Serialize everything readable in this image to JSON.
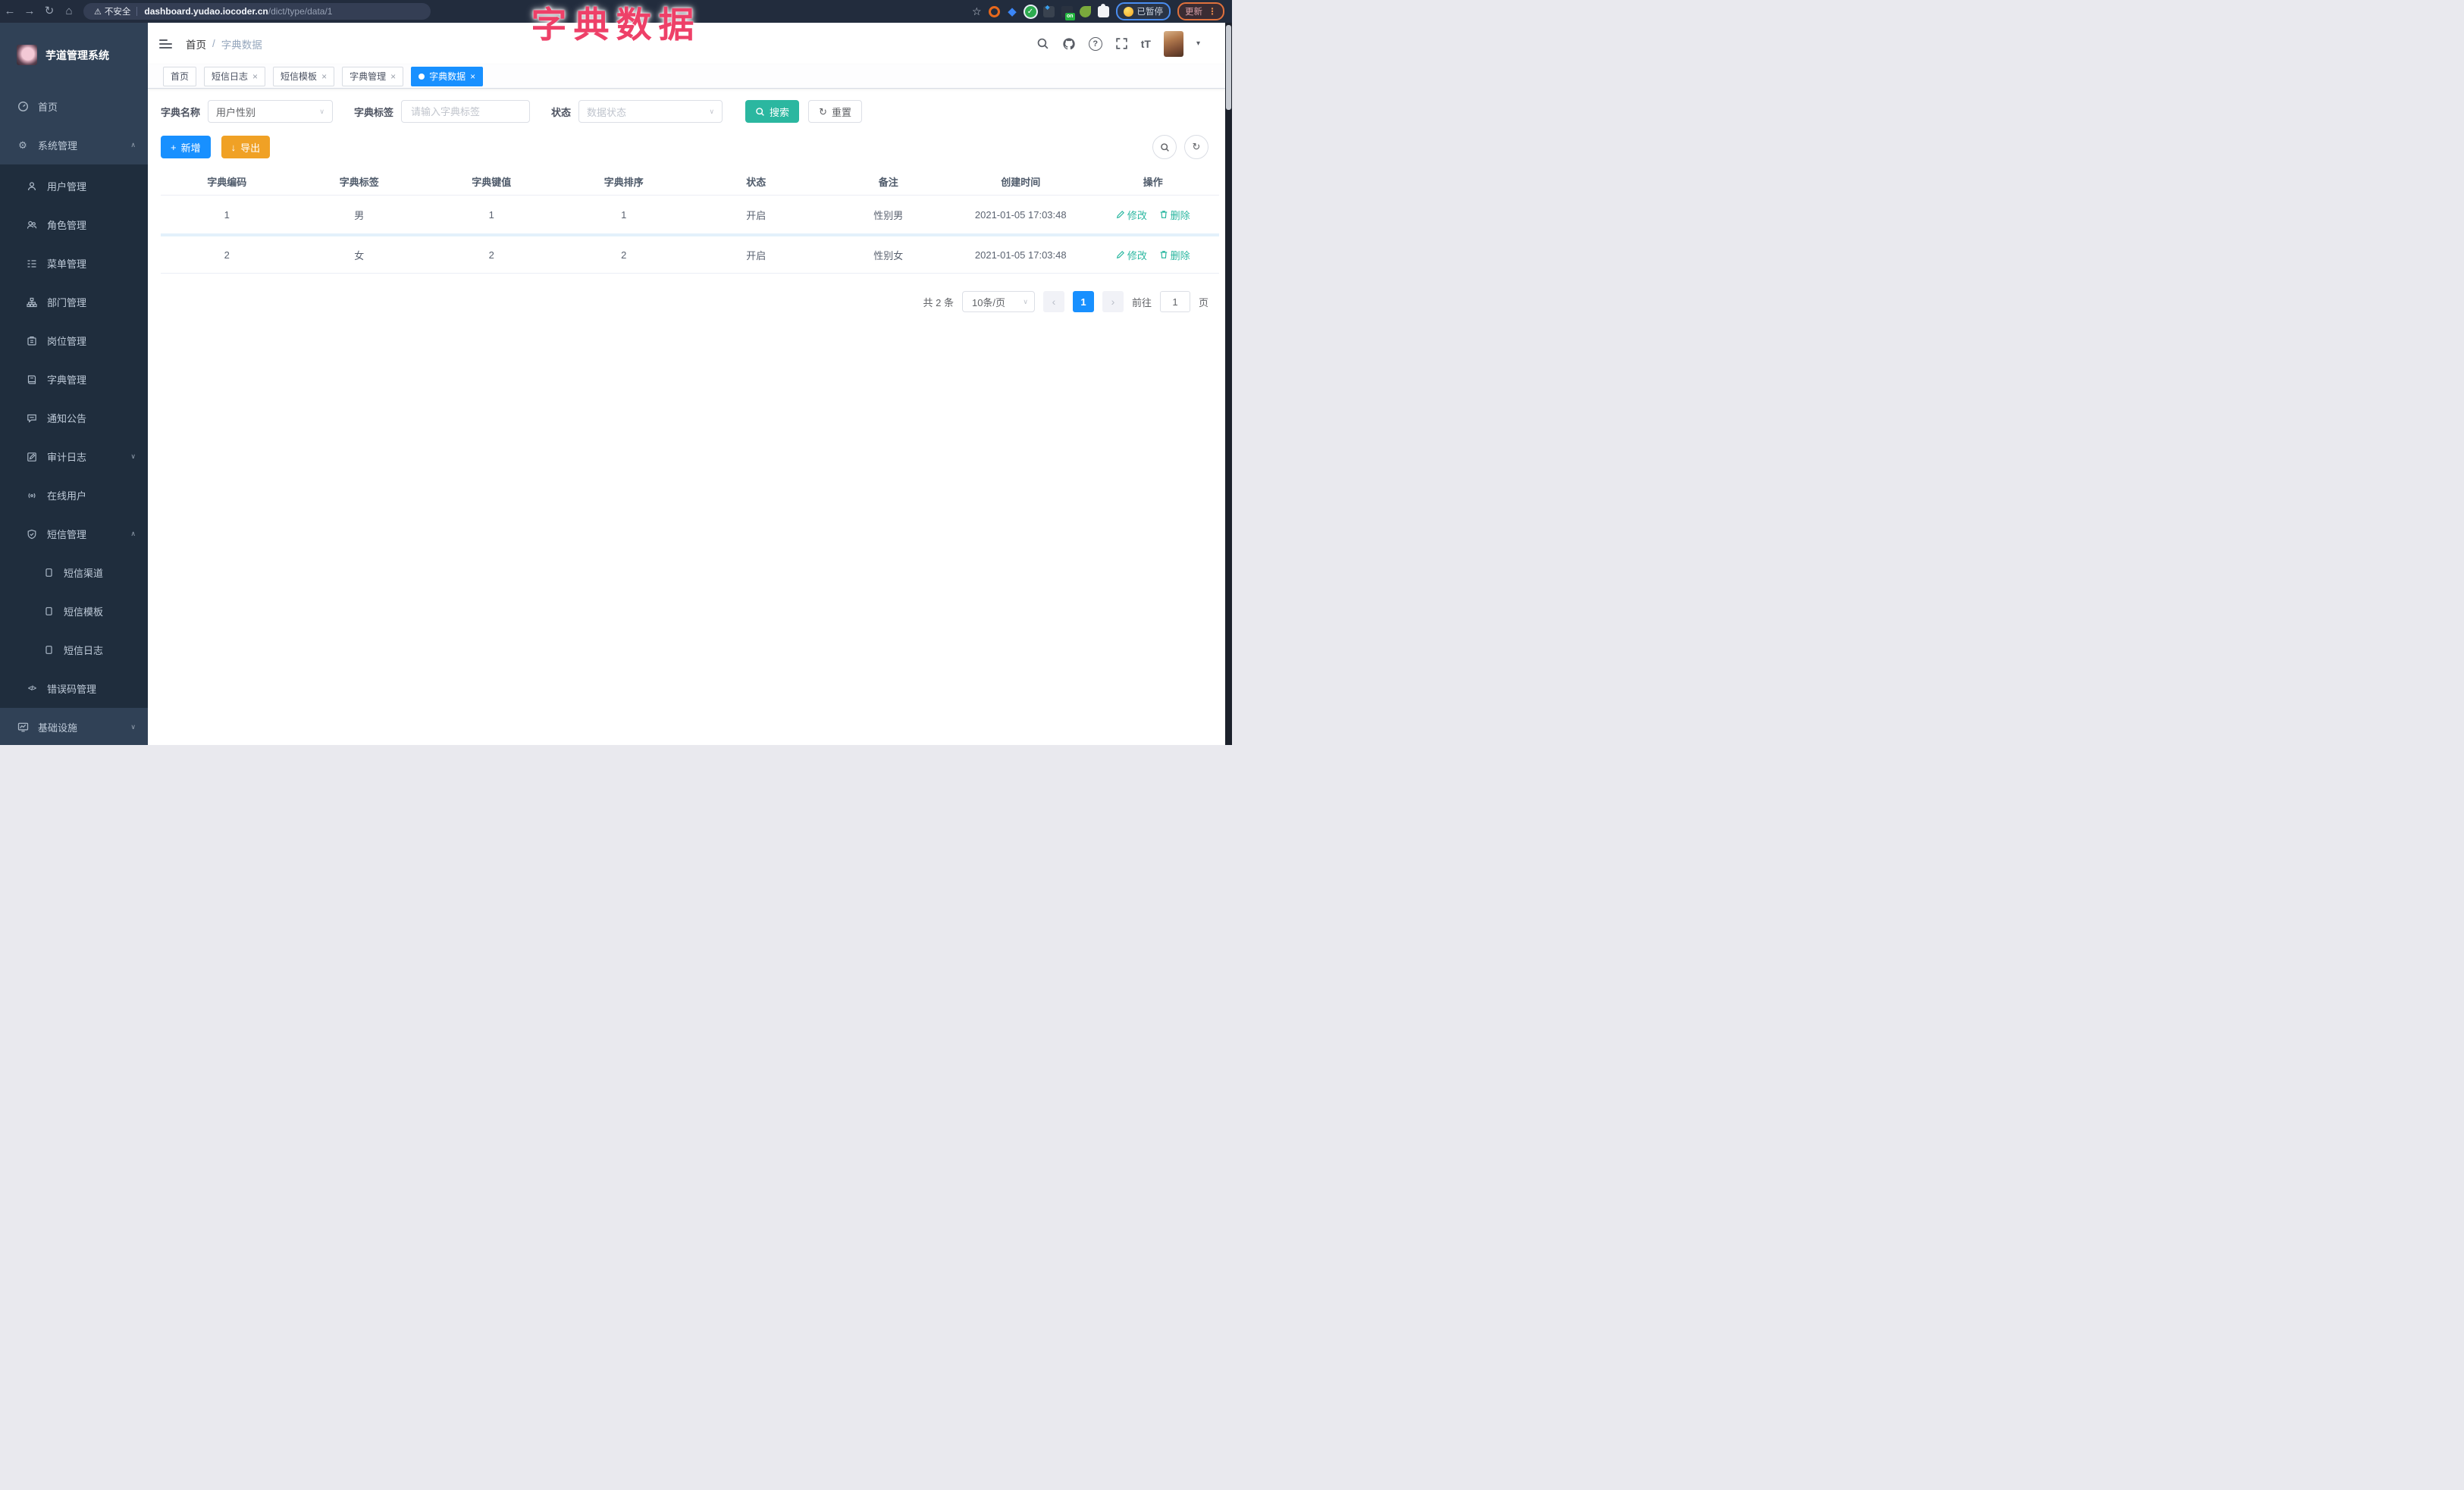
{
  "colors": {
    "primary_blue": "#1890ff",
    "theme_teal": "#2bb7a0",
    "warning_orange": "#f0a125",
    "title_pink": "#ee4068",
    "sidebar_bg": "#304156",
    "submenu_bg": "#1f2d3d"
  },
  "icons": {
    "back": "←",
    "forward": "→",
    "reload": "↻",
    "home": "⌂",
    "warning": "⚠",
    "star": "☆",
    "menu_dots": "⋮",
    "caret_down": "▾",
    "select_caret": "∨",
    "chevron_up": "∧",
    "chevron_down": "∨",
    "close": "×",
    "plus": "+",
    "download": "↓",
    "refresh": "↻",
    "prev": "‹",
    "next": "›",
    "gear": "⚙",
    "code": "</>",
    "help": "?",
    "font_size": "tT",
    "gem": "◆"
  },
  "browser": {
    "security_label": "不安全",
    "url_host": "dashboard.yudao.iocoder.cn",
    "url_path": "/dict/type/data/1",
    "paused_badge_label": "已暂停",
    "update_badge_label": "更新"
  },
  "overlay_title": "字典数据",
  "sidebar": {
    "logo_title": "芋道管理系统",
    "items": [
      {
        "label": "首页"
      },
      {
        "label": "系统管理"
      },
      {
        "label": "用户管理"
      },
      {
        "label": "角色管理"
      },
      {
        "label": "菜单管理"
      },
      {
        "label": "部门管理"
      },
      {
        "label": "岗位管理"
      },
      {
        "label": "字典管理"
      },
      {
        "label": "通知公告"
      },
      {
        "label": "审计日志"
      },
      {
        "label": "在线用户"
      },
      {
        "label": "短信管理"
      },
      {
        "label": "短信渠道"
      },
      {
        "label": "短信模板"
      },
      {
        "label": "短信日志"
      },
      {
        "label": "错误码管理"
      },
      {
        "label": "基础设施"
      }
    ]
  },
  "header": {
    "breadcrumb_home": "首页",
    "breadcrumb_sep": "/",
    "breadcrumb_current": "字典数据"
  },
  "tabs": [
    {
      "label": "首页"
    },
    {
      "label": "短信日志"
    },
    {
      "label": "短信模板"
    },
    {
      "label": "字典管理"
    },
    {
      "label": "字典数据"
    }
  ],
  "filters": {
    "dict_name_label": "字典名称",
    "dict_name_value": "用户性别",
    "dict_label_label": "字典标签",
    "dict_label_placeholder": "请输入字典标签",
    "status_label": "状态",
    "status_placeholder": "数据状态",
    "search_label": "搜索",
    "reset_label": "重置"
  },
  "toolbar": {
    "add_label": "新增",
    "export_label": "导出"
  },
  "table": {
    "columns": [
      "字典编码",
      "字典标签",
      "字典键值",
      "字典排序",
      "状态",
      "备注",
      "创建时间",
      "操作"
    ],
    "edit_label": "修改",
    "delete_label": "删除",
    "rows": [
      {
        "code": "1",
        "label": "男",
        "value": "1",
        "sort": "1",
        "status": "开启",
        "remark": "性别男",
        "created": "2021-01-05 17:03:48"
      },
      {
        "code": "2",
        "label": "女",
        "value": "2",
        "sort": "2",
        "status": "开启",
        "remark": "性别女",
        "created": "2021-01-05 17:03:48"
      }
    ]
  },
  "pagination": {
    "total_text": "共 2 条",
    "page_size_value": "10条/页",
    "current_page": "1",
    "goto_label": "前往",
    "goto_value": "1",
    "page_unit_label": "页"
  }
}
